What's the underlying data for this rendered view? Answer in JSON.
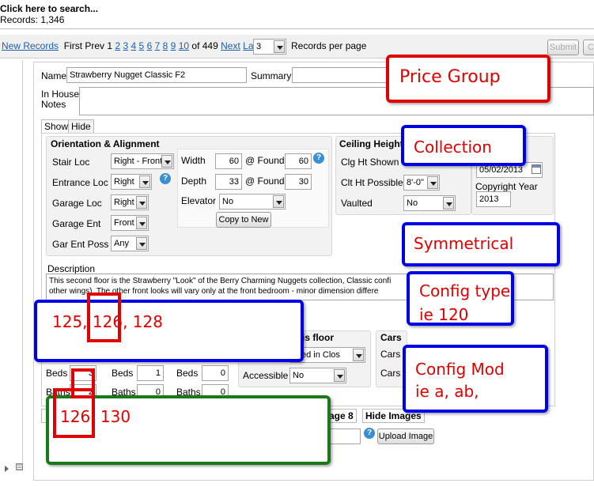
{
  "search": {
    "link": "Click here to search...",
    "records_label": "Records:",
    "records_count": "1,346"
  },
  "pager": {
    "new_records": "New Records",
    "first": "First",
    "prev": "Prev",
    "pages": [
      "1",
      "2",
      "3",
      "4",
      "5",
      "6",
      "7",
      "8",
      "9",
      "10"
    ],
    "of_label": "of 449",
    "next": "Next",
    "last": "Last",
    "per_page_value": "3",
    "per_page_label": "Records per page",
    "submit": "Submit",
    "cancel": "C"
  },
  "form": {
    "name_label": "Name",
    "name_value": "Strawberry Nugget Classic F2",
    "summary_label": "Summary",
    "notes_label_1": "In House",
    "notes_label_2": "Notes",
    "tab_show": "Show",
    "tab_hide": "Hide",
    "orientation": {
      "title": "Orientation & Alignment",
      "stair_loc_label": "Stair Loc",
      "stair_loc_value": "Right - Front",
      "entrance_loc_label": "Entrance Loc",
      "entrance_loc_value": "Right",
      "garage_loc_label": "Garage Loc",
      "garage_loc_value": "Right",
      "garage_ent_label": "Garage Ent",
      "garage_ent_value": "Front",
      "gar_ent_poss_label": "Gar Ent Poss",
      "gar_ent_poss_value": "Any",
      "width_label": "Width",
      "width_value": "60",
      "width_found_label": "@ Found",
      "width_found_value": "60",
      "depth_label": "Depth",
      "depth_value": "33",
      "depth_found_label": "@ Found",
      "depth_found_value": "30",
      "elevator_label": "Elevator",
      "elevator_value": "No",
      "copy_button": "Copy to New"
    },
    "ceiling": {
      "title": "Ceiling Height",
      "clg_shown_label": "Clg Ht Shown",
      "clt_possible_label": "Clt Ht Possible",
      "clt_possible_value": "8'-0\"",
      "vaulted_label": "Vaulted",
      "vaulted_value": "No"
    },
    "date_value": "05/02/2013",
    "copyright_label": "Copyright Year",
    "copyright_value": "2013",
    "description_label": "Description",
    "description_line1": "This second floor is the Strawberry \"Look\" of the Berry Charming Nuggets collection, Classic confi",
    "description_line2": "other wings).  The other front looks will vary only at the front bedroom - minor dimension differe",
    "this_floor": {
      "title": "is floor",
      "value": "cked in Clos",
      "accessible_label": "Accessible",
      "accessible_value": "No"
    },
    "cars": {
      "title": "Cars",
      "row1": "Cars",
      "row2": "Cars"
    },
    "beds_label": "Beds",
    "baths_label": "Baths",
    "beds_values": [
      "3",
      "1",
      "0"
    ],
    "baths_values": [
      "2",
      "0",
      "0"
    ],
    "image_tab": "age 8",
    "hide_images": "Hide Images",
    "upload_button": "Upload Image"
  },
  "annotations": {
    "price_group": "Price Group",
    "collection": "Collection",
    "symmetrical": "Symmetrical",
    "config_type_1": "Config type",
    "config_type_2": "ie 120",
    "config_mod_1": "Config Mod",
    "config_mod_2": "ie a, ab,",
    "numbers_top": "125, 126, 128",
    "numbers_bottom": "126, 130"
  },
  "colors": {
    "red": "#e00000",
    "blue": "#0000e6",
    "green": "#1a7a1a",
    "link": "#1f5fb0",
    "help": "#3a8fd3"
  }
}
